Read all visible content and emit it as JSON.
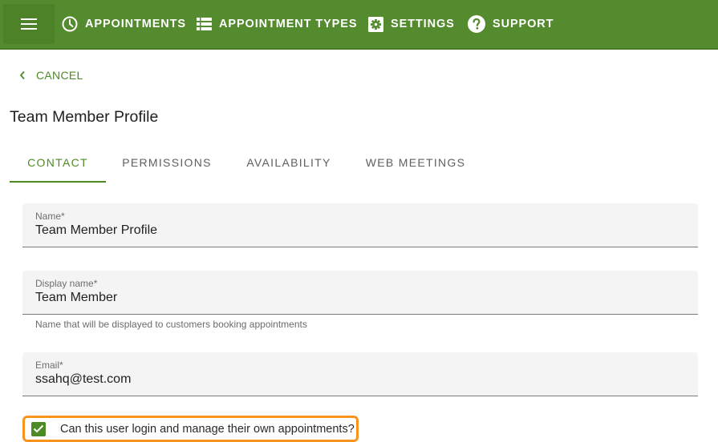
{
  "colors": {
    "brand_green": "#548b2e",
    "accent_green": "#4e8a24",
    "highlight_orange": "#f7941d"
  },
  "topbar": {
    "menu_icon": "hamburger-menu-icon",
    "nav": [
      {
        "label": "APPOINTMENTS",
        "icon": "clock-icon"
      },
      {
        "label": "APPOINTMENT TYPES",
        "icon": "list-icon"
      },
      {
        "label": "SETTINGS",
        "icon": "gear-icon"
      },
      {
        "label": "SUPPORT",
        "icon": "help-circle-icon"
      }
    ]
  },
  "cancel": {
    "label": "CANCEL",
    "icon": "chevron-left-icon"
  },
  "page_title": "Team Member Profile",
  "tabs": [
    {
      "label": "CONTACT",
      "active": true
    },
    {
      "label": "PERMISSIONS",
      "active": false
    },
    {
      "label": "AVAILABILITY",
      "active": false
    },
    {
      "label": "WEB MEETINGS",
      "active": false
    }
  ],
  "form": {
    "name": {
      "label": "Name*",
      "value": "Team Member Profile"
    },
    "display_name": {
      "label": "Display name*",
      "value": "Team Member",
      "hint": "Name that will be displayed to customers booking appointments"
    },
    "email": {
      "label": "Email*",
      "value": "ssahq@test.com"
    },
    "login_checkbox": {
      "label": "Can this user login and manage their own appointments?",
      "checked": true
    }
  }
}
